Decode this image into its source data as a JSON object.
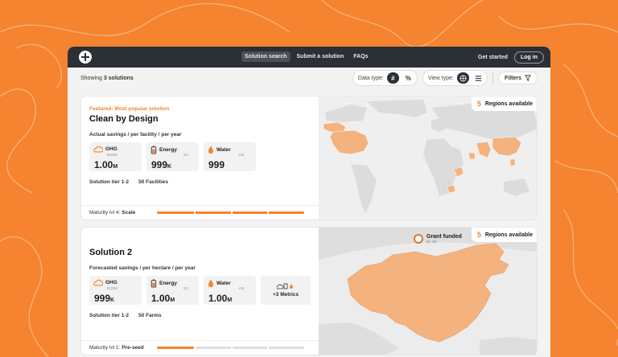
{
  "nav": {
    "links": [
      "Solution search",
      "Submit a solution",
      "FAQs"
    ],
    "get_started": "Get started",
    "login": "Log in"
  },
  "toolbar": {
    "showing_prefix": "Showing",
    "showing_count": "3 solutions",
    "data_type_label": "Data type:",
    "data_type_options": [
      "#",
      "%"
    ],
    "view_type_label": "View type:",
    "filters_label": "Filters"
  },
  "solutions": [
    {
      "featured": "Featured: Most popular solution",
      "title": "Clean by Design",
      "savings_label": "Actual savings / per facility / per year",
      "metrics": [
        {
          "name": "GHG",
          "unit": "tCO2e",
          "value": "1.00",
          "suffix": "M",
          "icon": "cloud-icon"
        },
        {
          "name": "Energy",
          "unit": "GJ",
          "value": "999",
          "suffix": "K",
          "icon": "battery-icon"
        },
        {
          "name": "Water",
          "unit": "m3",
          "value": "999",
          "suffix": "",
          "icon": "water-drop-icon"
        }
      ],
      "tags": [
        "Solution tier 1-2",
        "50 Facilities"
      ],
      "maturity_prefix": "Maturity lvl 4:",
      "maturity_stage": "Scale",
      "maturity_progress": 1.0,
      "regions_count": "5",
      "regions_label": "Regions available"
    },
    {
      "title": "Solution 2",
      "savings_label": "Forecasted savings / per hectare / per year",
      "metrics": [
        {
          "name": "GHG",
          "unit": "tCO2e",
          "value": "999",
          "suffix": "K",
          "icon": "cloud-icon"
        },
        {
          "name": "Energy",
          "unit": "GJ",
          "value": "1.00",
          "suffix": "M",
          "icon": "battery-icon"
        },
        {
          "name": "Water",
          "unit": "m3",
          "value": "1.00",
          "suffix": "M",
          "icon": "water-drop-icon"
        }
      ],
      "more_metrics": "+3 Metrics",
      "tags": [
        "Solution tier 1-2",
        "50 Farms"
      ],
      "maturity_prefix": "Maturity lvl 1:",
      "maturity_stage": "Pre-seed",
      "maturity_progress": 0.25,
      "grant_title": "Grant funded",
      "grant_by": "By abi",
      "regions_count": "5",
      "regions_label": "Regions available"
    }
  ],
  "colors": {
    "accent": "#f5832f",
    "nav_bg": "#2b2f36",
    "map_highlight": "#f4b27e"
  }
}
